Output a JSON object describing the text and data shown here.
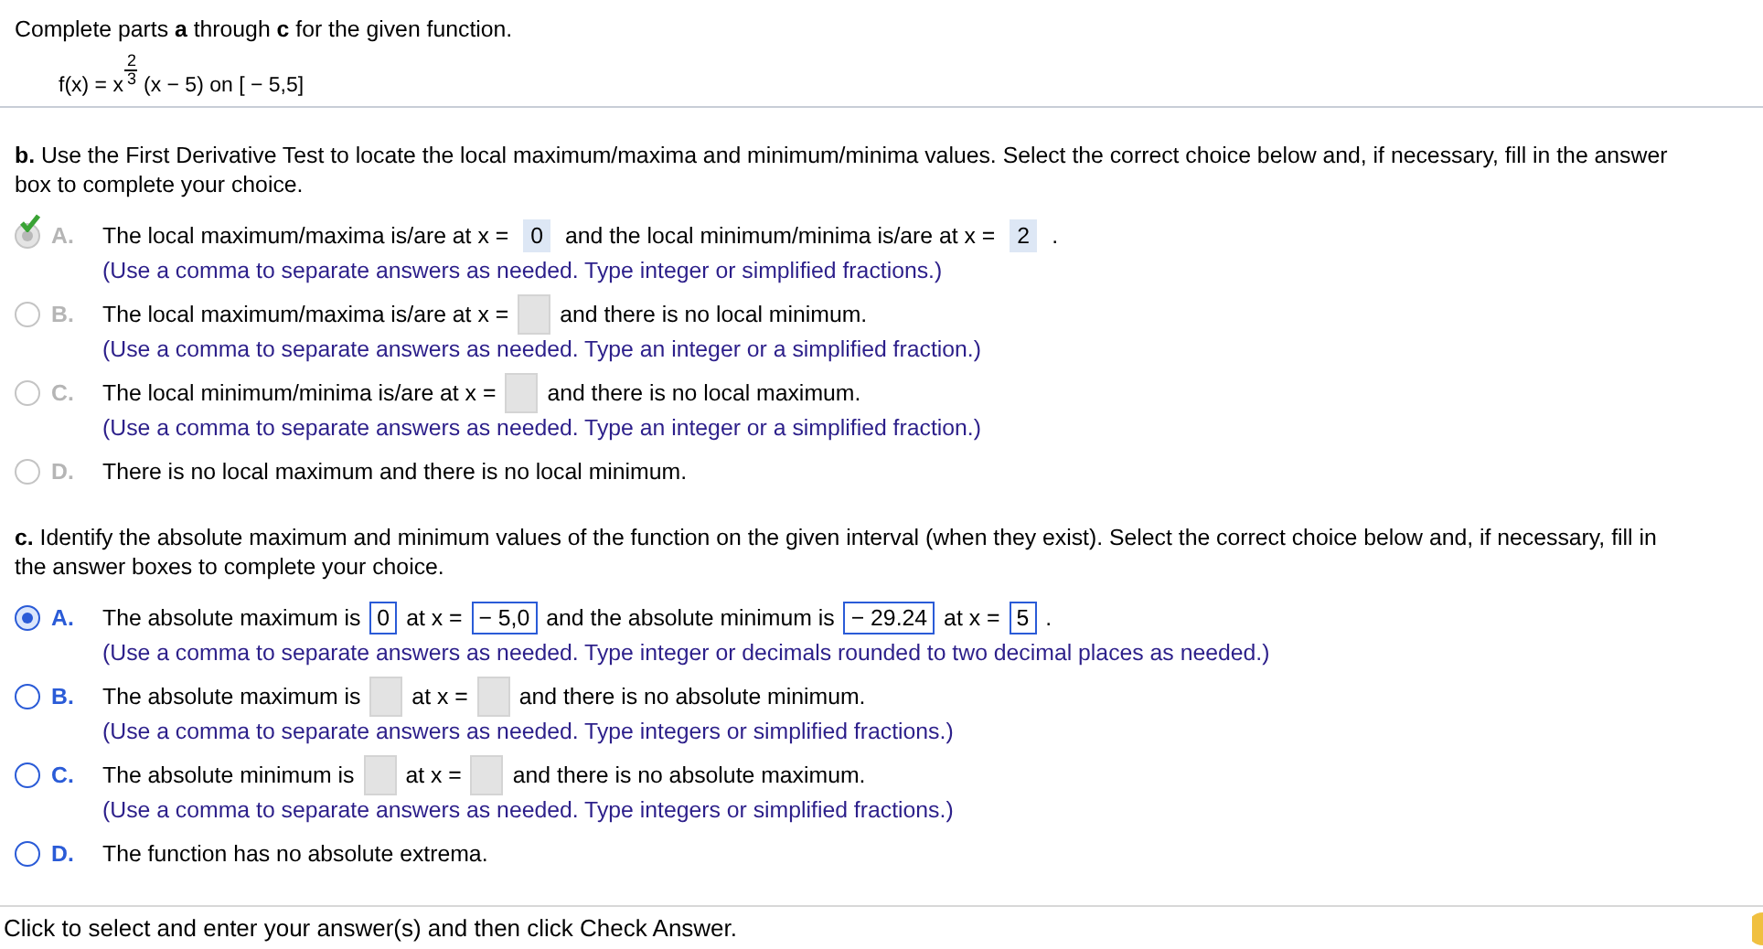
{
  "intro": "Complete parts **a** through **c** for the given function.",
  "formula": {
    "lhs": "f(x) = x",
    "exponent_numerator": "2",
    "exponent_denominator": "3",
    "rest": "(x − 5) on [ − 5,5]"
  },
  "parts": [
    {
      "prompt": "**b.** Use the First Derivative Test to locate the local maximum/maxima and minimum/minima values. Select the correct choice below and, if necessary, fill in the answer box to complete your choice.",
      "graded": true,
      "choices": [
        {
          "letter": "A.",
          "selected": true,
          "correct": true,
          "segments": [
            {
              "kind": "text",
              "text": "The local maximum/maxima is/are at x ="
            },
            {
              "kind": "field",
              "value": "0"
            },
            {
              "kind": "text",
              "text": "and the local minimum/minima is/are at x ="
            },
            {
              "kind": "field",
              "value": "2"
            },
            {
              "kind": "text",
              "text": "."
            }
          ],
          "hint": "(Use a comma to separate answers as needed. Type integer or simplified fractions.)"
        },
        {
          "letter": "B.",
          "selected": false,
          "correct": false,
          "segments": [
            {
              "kind": "text",
              "text": "The local maximum/maxima is/are at x ="
            },
            {
              "kind": "field"
            },
            {
              "kind": "text",
              "text": "and there is no local minimum."
            }
          ],
          "hint": "(Use a comma to separate answers as needed. Type an integer or a simplified fraction.)"
        },
        {
          "letter": "C.",
          "selected": false,
          "correct": false,
          "segments": [
            {
              "kind": "text",
              "text": "The local minimum/minima is/are at x ="
            },
            {
              "kind": "field"
            },
            {
              "kind": "text",
              "text": "and there is no local maximum."
            }
          ],
          "hint": "(Use a comma to separate answers as needed. Type an integer or a simplified fraction.)"
        },
        {
          "letter": "D.",
          "selected": false,
          "correct": false,
          "segments": [
            {
              "kind": "text",
              "text": "There is no local maximum and there is no local minimum."
            }
          ]
        }
      ]
    },
    {
      "prompt": "**c.** Identify the absolute maximum and minimum values of the function on the given interval (when they exist). Select the correct choice below and, if necessary, fill in the answer boxes to complete your choice.",
      "graded": false,
      "choices": [
        {
          "letter": "A.",
          "selected": true,
          "correct": false,
          "segments": [
            {
              "kind": "text",
              "text": "The absolute maximum is"
            },
            {
              "kind": "field",
              "value": "0"
            },
            {
              "kind": "text",
              "text": "at x ="
            },
            {
              "kind": "field",
              "value": "− 5,0"
            },
            {
              "kind": "text",
              "text": "and the absolute minimum is"
            },
            {
              "kind": "field",
              "value": "− 29.24"
            },
            {
              "kind": "text",
              "text": "at x ="
            },
            {
              "kind": "field",
              "value": "5"
            },
            {
              "kind": "text",
              "text": "."
            }
          ],
          "hint": "(Use a comma to separate answers as needed. Type integer or decimals rounded to two decimal places as needed.)"
        },
        {
          "letter": "B.",
          "selected": false,
          "correct": false,
          "segments": [
            {
              "kind": "text",
              "text": "The absolute maximum is"
            },
            {
              "kind": "field"
            },
            {
              "kind": "text",
              "text": "at x ="
            },
            {
              "kind": "field"
            },
            {
              "kind": "text",
              "text": "and there is no absolute minimum."
            }
          ],
          "hint": "(Use a comma to separate answers as needed. Type integers or simplified fractions.)"
        },
        {
          "letter": "C.",
          "selected": false,
          "correct": false,
          "segments": [
            {
              "kind": "text",
              "text": "The absolute minimum is"
            },
            {
              "kind": "field"
            },
            {
              "kind": "text",
              "text": "at x ="
            },
            {
              "kind": "field"
            },
            {
              "kind": "text",
              "text": "and there is no absolute maximum."
            }
          ],
          "hint": "(Use a comma to separate answers as needed. Type integers or simplified fractions.)"
        },
        {
          "letter": "D.",
          "selected": false,
          "correct": false,
          "segments": [
            {
              "kind": "text",
              "text": "The function has no absolute extrema."
            }
          ]
        }
      ]
    }
  ],
  "footer": "Click to select and enter your answer(s) and then click Check Answer."
}
